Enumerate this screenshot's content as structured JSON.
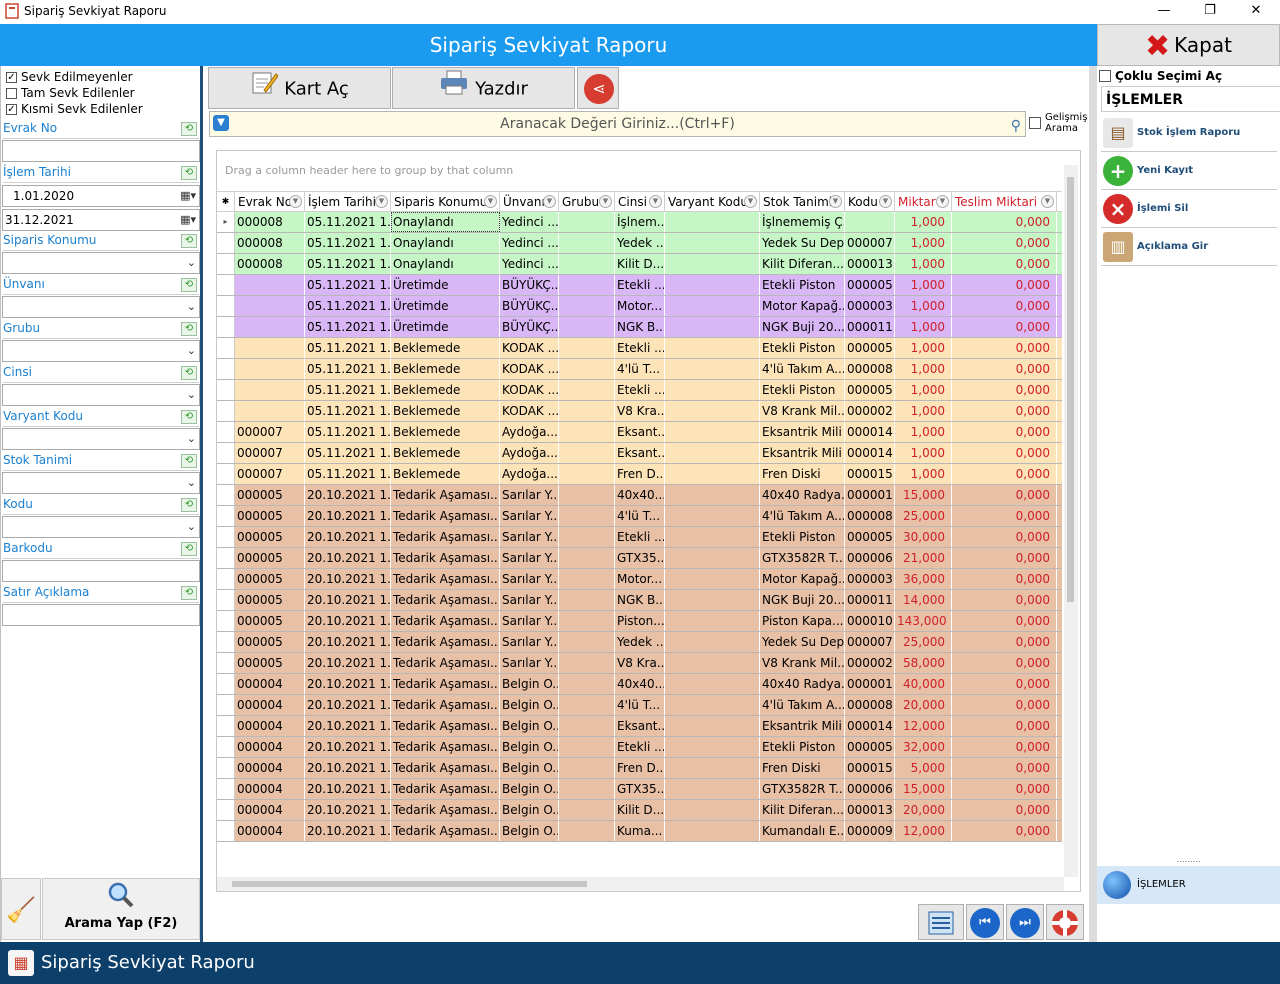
{
  "window": {
    "title": "Sipariş Sevkiyat Raporu",
    "minimize": "—",
    "maximize": "❐",
    "close": "✕"
  },
  "banner": {
    "title": "Sipariş Sevkiyat Raporu"
  },
  "close_button": {
    "label": "Kapat"
  },
  "filters": {
    "checks": [
      {
        "label": "Sevk Edilmeyenler",
        "checked": true
      },
      {
        "label": "Tam Sevk Edilenler",
        "checked": false
      },
      {
        "label": "Kısmi Sevk Edilenler",
        "checked": true
      }
    ],
    "fields": [
      {
        "label": "Evrak No",
        "value": ""
      },
      {
        "label": "İşlem Tarihi",
        "value_from": "1.01.2020",
        "value_to": "31.12.2021"
      },
      {
        "label": "Siparis Konumu",
        "value": ""
      },
      {
        "label": "Ünvanı",
        "value": ""
      },
      {
        "label": "Grubu",
        "value": ""
      },
      {
        "label": "Cinsi",
        "value": ""
      },
      {
        "label": "Varyant Kodu",
        "value": ""
      },
      {
        "label": "Stok Tanimi",
        "value": ""
      },
      {
        "label": "Kodu",
        "value": ""
      },
      {
        "label": "Barkodu",
        "value": ""
      },
      {
        "label": "Satır Açıklama",
        "value": ""
      }
    ],
    "search_button": "Arama Yap (F2)"
  },
  "toolbar": {
    "open_card": "Kart Aç",
    "print": "Yazdır"
  },
  "search": {
    "placeholder": "Aranacak Değeri Giriniz...(Ctrl+F)",
    "advanced": "Gelişmiş Arama"
  },
  "grid": {
    "group_hint": "Drag a column header here to group by that column",
    "columns": [
      "Evrak No",
      "İşlem Tarihi",
      "Siparis Konumu",
      "Ünvanı",
      "Grubu",
      "Cinsi",
      "Varyant Kodu",
      "Stok Tanimi",
      "Kodu",
      "Miktar",
      "Teslim Miktari"
    ],
    "rows": [
      {
        "c": [
          "000008",
          "05.11.2021 1...",
          "Onaylandı",
          "Yedinci ...",
          "",
          "İşlnem...",
          "",
          "İşlnememiş Ç...",
          "",
          "1,000",
          "0,000"
        ],
        "bg": "#c6f6c6"
      },
      {
        "c": [
          "000008",
          "05.11.2021 1...",
          "Onaylandı",
          "Yedinci ...",
          "",
          "Yedek ...",
          "",
          "Yedek Su Dep...",
          "000007",
          "1,000",
          "0,000"
        ],
        "bg": "#c6f6c6"
      },
      {
        "c": [
          "000008",
          "05.11.2021 1...",
          "Onaylandı",
          "Yedinci ...",
          "",
          "Kilit D...",
          "",
          "Kilit Diferan...",
          "000013",
          "1,000",
          "0,000"
        ],
        "bg": "#c6f6c6"
      },
      {
        "c": [
          "",
          "05.11.2021 1...",
          "Üretimde",
          "BÜYÜKÇ...",
          "",
          "Etekli ...",
          "",
          "Etekli Piston",
          "000005",
          "1,000",
          "0,000"
        ],
        "bg": "#d9b6f6"
      },
      {
        "c": [
          "",
          "05.11.2021 1...",
          "Üretimde",
          "BÜYÜKÇ...",
          "",
          "Motor...",
          "",
          "Motor Kapağ...",
          "000003",
          "1,000",
          "0,000"
        ],
        "bg": "#d9b6f6"
      },
      {
        "c": [
          "",
          "05.11.2021 1...",
          "Üretimde",
          "BÜYÜKÇ...",
          "",
          "NGK B...",
          "",
          "NGK Buji 20...",
          "000011",
          "1,000",
          "0,000"
        ],
        "bg": "#d9b6f6"
      },
      {
        "c": [
          "",
          "05.11.2021 1...",
          "Beklemede",
          "KODAK ...",
          "",
          "Etekli ...",
          "",
          "Etekli Piston",
          "000005",
          "1,000",
          "0,000"
        ],
        "bg": "#fde3b8"
      },
      {
        "c": [
          "",
          "05.11.2021 1...",
          "Beklemede",
          "KODAK ...",
          "",
          "4'lü T...",
          "",
          "4'lü Takım A...",
          "000008",
          "1,000",
          "0,000"
        ],
        "bg": "#fde3b8"
      },
      {
        "c": [
          "",
          "05.11.2021 1...",
          "Beklemede",
          "KODAK ...",
          "",
          "Etekli ...",
          "",
          "Etekli Piston",
          "000005",
          "1,000",
          "0,000"
        ],
        "bg": "#fde3b8"
      },
      {
        "c": [
          "",
          "05.11.2021 1...",
          "Beklemede",
          "KODAK ...",
          "",
          "V8 Kra...",
          "",
          "V8 Krank Mil...",
          "000002",
          "1,000",
          "0,000"
        ],
        "bg": "#fde3b8"
      },
      {
        "c": [
          "000007",
          "05.11.2021 1...",
          "Beklemede",
          "Aydoğa...",
          "",
          "Eksant...",
          "",
          "Eksantrik Mili",
          "000014",
          "1,000",
          "0,000"
        ],
        "bg": "#fde3b8"
      },
      {
        "c": [
          "000007",
          "05.11.2021 1...",
          "Beklemede",
          "Aydoğa...",
          "",
          "Eksant...",
          "",
          "Eksantrik Mili",
          "000014",
          "1,000",
          "0,000"
        ],
        "bg": "#fde3b8"
      },
      {
        "c": [
          "000007",
          "05.11.2021 1...",
          "Beklemede",
          "Aydoğa...",
          "",
          "Fren D...",
          "",
          "Fren Diski",
          "000015",
          "1,000",
          "0,000"
        ],
        "bg": "#fde3b8"
      },
      {
        "c": [
          "000005",
          "20.10.2021 1...",
          "Tedarik Aşaması...",
          "Sarılar Y...",
          "",
          "40x40...",
          "",
          "40x40 Radya...",
          "000001",
          "15,000",
          "0,000"
        ],
        "bg": "#e8c0a6"
      },
      {
        "c": [
          "000005",
          "20.10.2021 1...",
          "Tedarik Aşaması...",
          "Sarılar Y...",
          "",
          "4'lü T...",
          "",
          "4'lü Takım A...",
          "000008",
          "25,000",
          "0,000"
        ],
        "bg": "#e8c0a6"
      },
      {
        "c": [
          "000005",
          "20.10.2021 1...",
          "Tedarik Aşaması...",
          "Sarılar Y...",
          "",
          "Etekli ...",
          "",
          "Etekli Piston",
          "000005",
          "30,000",
          "0,000"
        ],
        "bg": "#e8c0a6"
      },
      {
        "c": [
          "000005",
          "20.10.2021 1...",
          "Tedarik Aşaması...",
          "Sarılar Y...",
          "",
          "GTX35...",
          "",
          "GTX3582R T...",
          "000006",
          "21,000",
          "0,000"
        ],
        "bg": "#e8c0a6"
      },
      {
        "c": [
          "000005",
          "20.10.2021 1...",
          "Tedarik Aşaması...",
          "Sarılar Y...",
          "",
          "Motor...",
          "",
          "Motor Kapağ...",
          "000003",
          "36,000",
          "0,000"
        ],
        "bg": "#e8c0a6"
      },
      {
        "c": [
          "000005",
          "20.10.2021 1...",
          "Tedarik Aşaması...",
          "Sarılar Y...",
          "",
          "NGK B...",
          "",
          "NGK Buji 20...",
          "000011",
          "14,000",
          "0,000"
        ],
        "bg": "#e8c0a6"
      },
      {
        "c": [
          "000005",
          "20.10.2021 1...",
          "Tedarik Aşaması...",
          "Sarılar Y...",
          "",
          "Piston...",
          "",
          "Piston Kapa...",
          "000010",
          "143,000",
          "0,000"
        ],
        "bg": "#e8c0a6"
      },
      {
        "c": [
          "000005",
          "20.10.2021 1...",
          "Tedarik Aşaması...",
          "Sarılar Y...",
          "",
          "Yedek ...",
          "",
          "Yedek Su Dep...",
          "000007",
          "25,000",
          "0,000"
        ],
        "bg": "#e8c0a6"
      },
      {
        "c": [
          "000005",
          "20.10.2021 1...",
          "Tedarik Aşaması...",
          "Sarılar Y...",
          "",
          "V8 Kra...",
          "",
          "V8 Krank Mil...",
          "000002",
          "58,000",
          "0,000"
        ],
        "bg": "#e8c0a6"
      },
      {
        "c": [
          "000004",
          "20.10.2021 1...",
          "Tedarik Aşaması...",
          "Belgin O...",
          "",
          "40x40...",
          "",
          "40x40 Radya...",
          "000001",
          "40,000",
          "0,000"
        ],
        "bg": "#e8c0a6"
      },
      {
        "c": [
          "000004",
          "20.10.2021 1...",
          "Tedarik Aşaması...",
          "Belgin O...",
          "",
          "4'lü T...",
          "",
          "4'lü Takım A...",
          "000008",
          "20,000",
          "0,000"
        ],
        "bg": "#e8c0a6"
      },
      {
        "c": [
          "000004",
          "20.10.2021 1...",
          "Tedarik Aşaması...",
          "Belgin O...",
          "",
          "Eksant...",
          "",
          "Eksantrik Mili",
          "000014",
          "12,000",
          "0,000"
        ],
        "bg": "#e8c0a6"
      },
      {
        "c": [
          "000004",
          "20.10.2021 1...",
          "Tedarik Aşaması...",
          "Belgin O...",
          "",
          "Etekli ...",
          "",
          "Etekli Piston",
          "000005",
          "32,000",
          "0,000"
        ],
        "bg": "#e8c0a6"
      },
      {
        "c": [
          "000004",
          "20.10.2021 1...",
          "Tedarik Aşaması...",
          "Belgin O...",
          "",
          "Fren D...",
          "",
          "Fren Diski",
          "000015",
          "5,000",
          "0,000"
        ],
        "bg": "#e8c0a6"
      },
      {
        "c": [
          "000004",
          "20.10.2021 1...",
          "Tedarik Aşaması...",
          "Belgin O...",
          "",
          "GTX35...",
          "",
          "GTX3582R T...",
          "000006",
          "15,000",
          "0,000"
        ],
        "bg": "#e8c0a6"
      },
      {
        "c": [
          "000004",
          "20.10.2021 1...",
          "Tedarik Aşaması...",
          "Belgin O...",
          "",
          "Kilit D...",
          "",
          "Kilit Diferan...",
          "000013",
          "20,000",
          "0,000"
        ],
        "bg": "#e8c0a6"
      },
      {
        "c": [
          "000004",
          "20.10.2021 1...",
          "Tedarik Aşaması...",
          "Belgin O...",
          "",
          "Kuma...",
          "",
          "Kumandalı E...",
          "000009",
          "12,000",
          "0,000"
        ],
        "bg": "#e8c0a6"
      }
    ]
  },
  "right": {
    "multi_select": "Çoklu Seçimi Aç",
    "header": "İŞLEMLER",
    "actions": [
      {
        "label": "Stok İşlem Raporu",
        "icon": "report-icon"
      },
      {
        "label": "Yeni Kayıt",
        "icon": "plus-icon"
      },
      {
        "label": "İşlemi Sil",
        "icon": "delete-icon"
      },
      {
        "label": "Açıklama Gir",
        "icon": "clipboard-icon"
      }
    ],
    "footer": "İŞLEMLER"
  },
  "status": {
    "title": "Sipariş Sevkiyat Raporu"
  }
}
